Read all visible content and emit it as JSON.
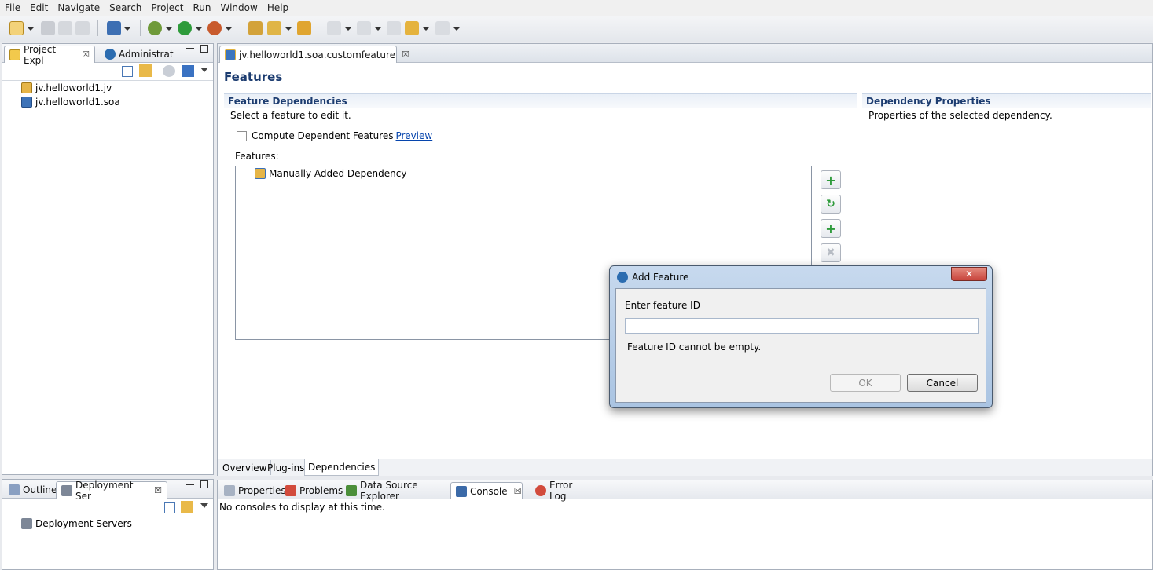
{
  "menu": [
    "File",
    "Edit",
    "Navigate",
    "Search",
    "Project",
    "Run",
    "Window",
    "Help"
  ],
  "left_top_panel": {
    "tabs": [
      "Project Expl",
      "Administrat"
    ],
    "tree": [
      "jv.helloworld1.jv",
      "jv.helloworld1.soa"
    ]
  },
  "left_bottom_panel": {
    "tabs": [
      "Outline",
      "Deployment Ser"
    ],
    "tree": [
      "Deployment Servers"
    ]
  },
  "editor": {
    "tab_label": "jv.helloworld1.soa.customfeature",
    "page_title": "Features",
    "feature_dependencies": {
      "title": "Feature Dependencies",
      "description": "Select a feature to edit it.",
      "compute_checkbox_label": "Compute Dependent Features",
      "preview_link": "Preview",
      "features_label": "Features:",
      "features": [
        "Manually Added Dependency"
      ]
    },
    "dependency_properties": {
      "title": "Dependency Properties",
      "description": "Properties of the selected dependency."
    },
    "bottom_tabs": [
      "Overview",
      "Plug-ins",
      "Dependencies"
    ]
  },
  "bottom_panel": {
    "tabs": [
      "Properties",
      "Problems",
      "Data Source Explorer",
      "Console",
      "Error Log"
    ],
    "message": "No consoles to display at this time."
  },
  "dialog": {
    "title": "Add Feature",
    "prompt": "Enter feature ID",
    "input_value": "",
    "error": "Feature ID cannot be empty.",
    "ok_label": "OK",
    "cancel_label": "Cancel"
  },
  "colors": {
    "section_title": "#1c3c70",
    "link": "#0645ad",
    "close_button": "#c7433b"
  }
}
